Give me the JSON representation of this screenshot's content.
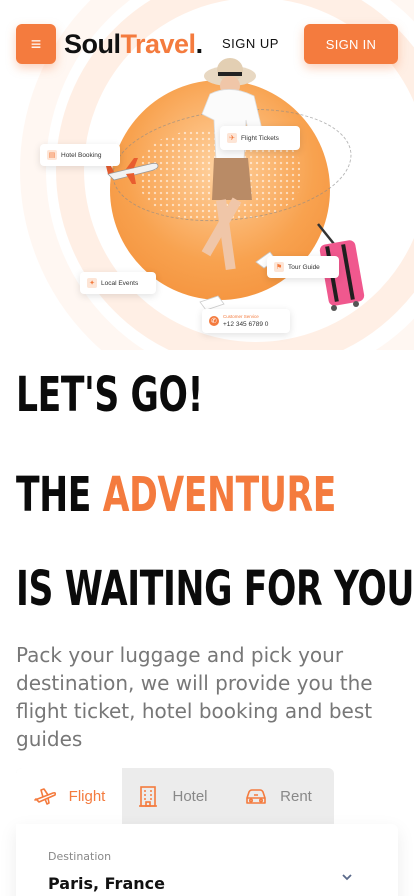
{
  "header": {
    "menu_icon": "≡",
    "logo_soul": "Soul",
    "logo_travel": "Travel",
    "logo_dot": ".",
    "signup_label": "SIGN UP",
    "signin_label": "SIGN IN"
  },
  "hero": {
    "cards": {
      "flight_tickets": "Flight Tickets",
      "hotel_booking": "Hotel Booking",
      "tour_guide": "Tour Guide",
      "local_events": "Local Events",
      "customer_service_title": "Customer Service",
      "customer_service_phone": "+12 345 6789 0"
    }
  },
  "headline": {
    "line1": "LET'S GO!",
    "line2_prefix": "THE ",
    "line2_accent": "ADVENTURE",
    "line3": "IS WAITING FOR YOU"
  },
  "description": "Pack your luggage and pick your destination, we will provide you the flight ticket, hotel booking and best guides",
  "tabs": [
    {
      "label": "Flight",
      "icon": "plane-icon",
      "active": true
    },
    {
      "label": "Hotel",
      "icon": "building-icon",
      "active": false
    },
    {
      "label": "Rent",
      "icon": "car-icon",
      "active": false
    }
  ],
  "form": {
    "destination_label": "Destination",
    "destination_value": "Paris, France"
  },
  "colors": {
    "accent": "#f47b3e",
    "text": "#111111",
    "muted": "#777777",
    "tab_bg": "#ececec"
  }
}
